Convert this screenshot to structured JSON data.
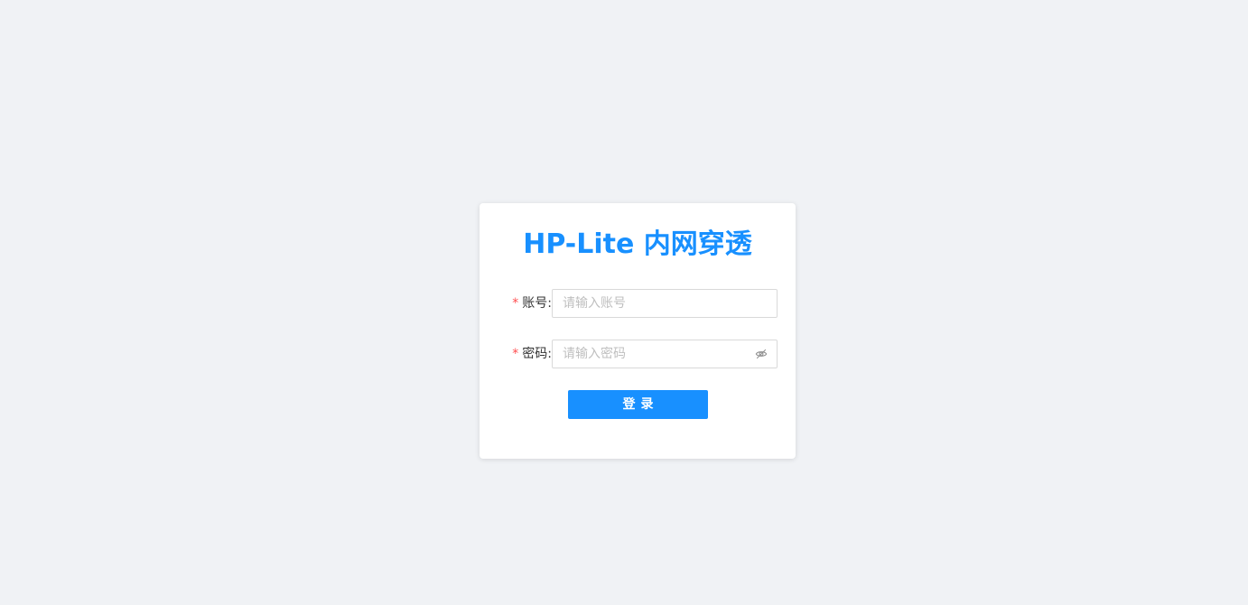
{
  "login": {
    "title": "HP-Lite 内网穿透",
    "required_mark": "*",
    "username": {
      "label": "账号:",
      "placeholder": "请输入账号",
      "value": ""
    },
    "password": {
      "label": "密码:",
      "placeholder": "请输入密码",
      "value": "",
      "toggle_icon": "eye-invisible-icon"
    },
    "submit_label": "登录"
  },
  "colors": {
    "background": "#f0f2f5",
    "primary": "#1890ff",
    "required": "#ff4d4f"
  }
}
